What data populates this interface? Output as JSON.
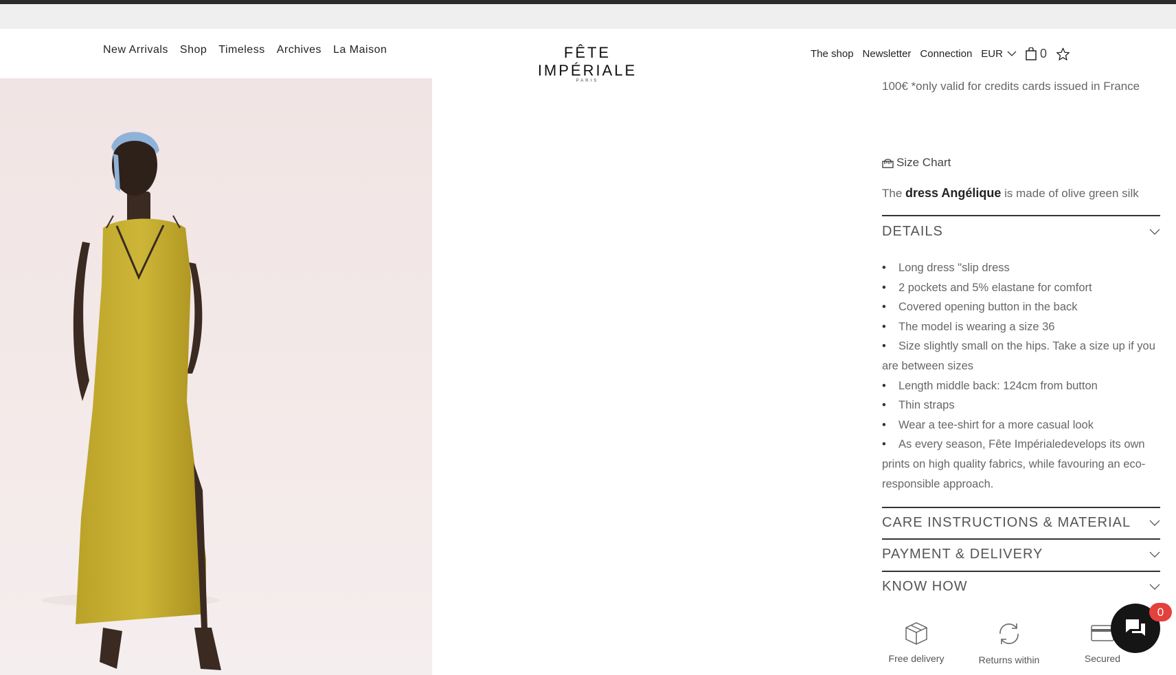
{
  "nav": {
    "left": [
      "New Arrivals",
      "Shop",
      "Timeless",
      "Archives",
      "La Maison"
    ],
    "logo_main": "FÊTE IMPÉRIALE",
    "logo_sub": "PARIS",
    "right": {
      "shop": "The shop",
      "newsletter": "Newsletter",
      "connection": "Connection",
      "currency": "EUR",
      "cart_count": "0"
    }
  },
  "product": {
    "credit_note": "100€ *only valid for credits cards issued in France",
    "size_chart": "Size Chart",
    "desc_prefix": "The",
    "desc_name": "dress Angélique",
    "desc_suffix": "is made of olive green silk",
    "details_title": "DETAILS",
    "details": [
      "Long dress \"slip dress",
      "2 pockets and 5% elastane for comfort",
      "Covered opening button in the back",
      "The model is wearing a size 36",
      "Size slightly small on the hips. Take a size up if you are between sizes",
      "Length middle back: 124cm from button",
      "Thin straps",
      "Wear a tee-shirt for a more casual look",
      "As every season, Fête Impérialedevelops its own prints on high quality fabrics, while favouring an eco-responsible approach."
    ],
    "care_title": "CARE INSTRUCTIONS & MATERIAL",
    "payment_title": "PAYMENT & DELIVERY",
    "knowhow_title": "KNOW HOW"
  },
  "features": [
    {
      "icon": "box-icon",
      "label": "Free delivery"
    },
    {
      "icon": "returns-icon",
      "label": "Returns within"
    },
    {
      "icon": "card-icon",
      "label": "Secured"
    }
  ],
  "chat": {
    "badge": "0"
  },
  "colors": {
    "accent_badge": "#e4403c",
    "dress": "#c4ad2e",
    "photo_bg": "#f2e6e6"
  }
}
